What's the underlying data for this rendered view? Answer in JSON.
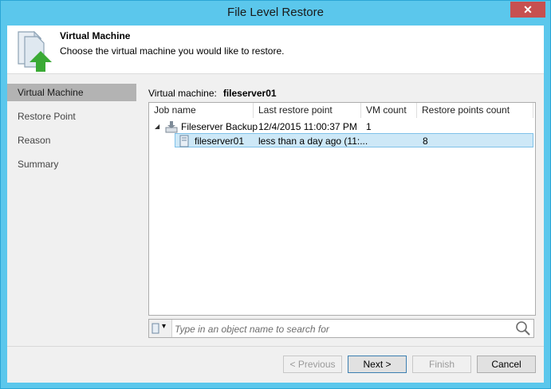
{
  "window": {
    "title": "File Level Restore",
    "close_glyph": "✕"
  },
  "header": {
    "title": "Virtual Machine",
    "description": "Choose the virtual machine you would like to restore.",
    "icon": "restore-document-icon"
  },
  "sidebar": {
    "items": [
      {
        "label": "Virtual Machine",
        "active": true
      },
      {
        "label": "Restore Point",
        "active": false
      },
      {
        "label": "Reason",
        "active": false
      },
      {
        "label": "Summary",
        "active": false
      }
    ]
  },
  "vm": {
    "label": "Virtual machine:",
    "value": "fileserver01"
  },
  "grid": {
    "columns": [
      "Job name",
      "Last restore point",
      "VM count",
      "Restore points count"
    ],
    "rows": [
      {
        "name": "Fileserver Backup",
        "last": "12/4/2015 11:00:37 PM",
        "vm_count": "1",
        "rp_count": "",
        "expand_glyph": "◢"
      },
      {
        "name": "fileserver01",
        "last": "less than a day ago (11:...",
        "vm_count": "",
        "rp_count": "8"
      }
    ]
  },
  "search": {
    "placeholder": "Type in an object name to search for",
    "type_glyph": "▾"
  },
  "buttons": {
    "previous": "< Previous",
    "next": "Next >",
    "finish": "Finish",
    "cancel": "Cancel"
  },
  "colors": {
    "titlebar": "#5bc7ec",
    "close": "#c75050",
    "selection": "#cde8f7",
    "accent_green": "#3aaa35"
  }
}
